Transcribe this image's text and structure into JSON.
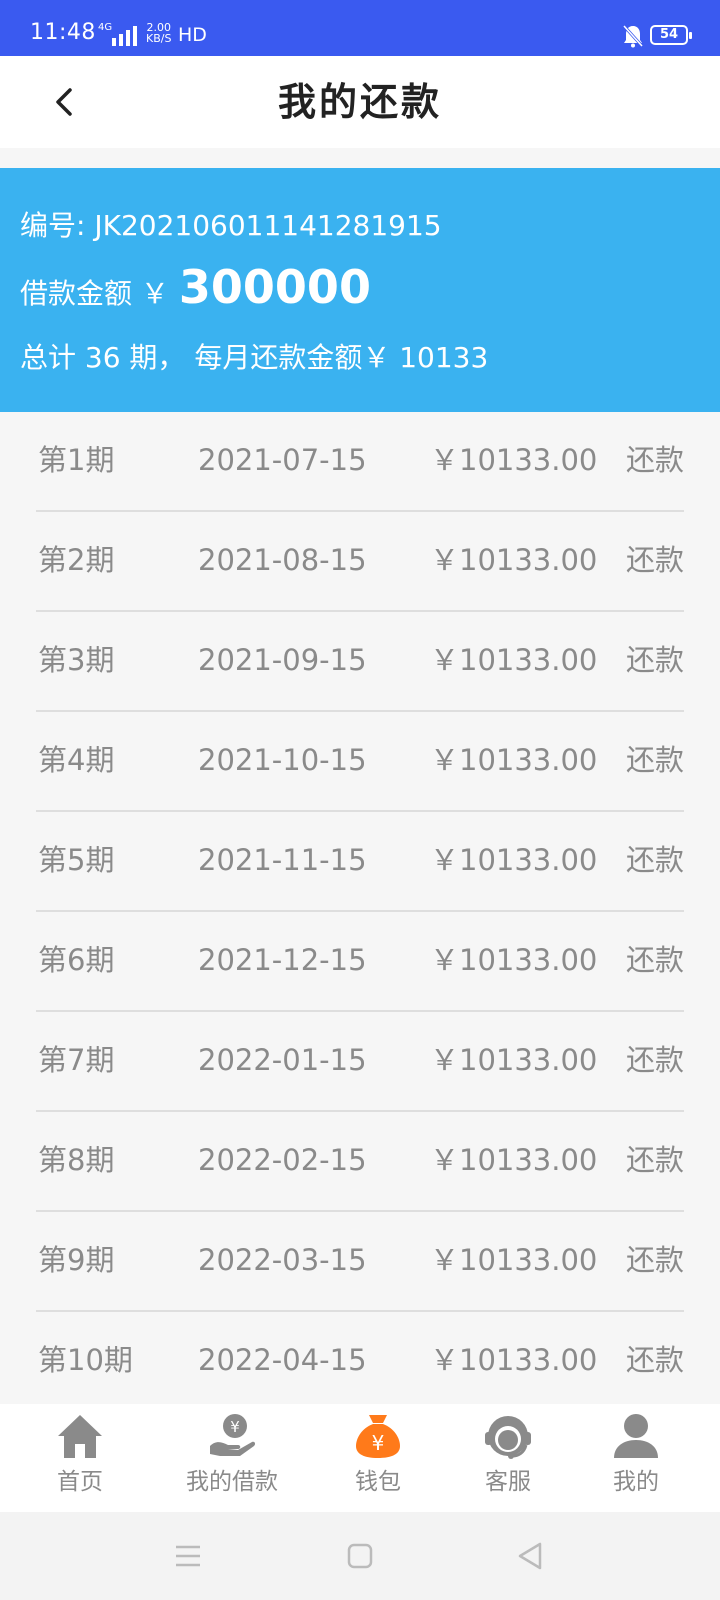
{
  "status_bar": {
    "time": "11:48",
    "network": "4G",
    "speed_value": "2.00",
    "speed_unit": "KB/S",
    "hd": "HD",
    "battery": "54"
  },
  "header": {
    "title": "我的还款"
  },
  "summary": {
    "code_label": "编号:",
    "code": "JK20210601114128191​5",
    "amount_label": "借款金额 ￥",
    "amount": "300000",
    "plan_text": "总计 36 期， 每月还款金额￥ 10133"
  },
  "installments": [
    {
      "period": "第1期",
      "date": "2021-07-15",
      "amount": "￥10133.00",
      "action": "还款"
    },
    {
      "period": "第2期",
      "date": "2021-08-15",
      "amount": "￥10133.00",
      "action": "还款"
    },
    {
      "period": "第3期",
      "date": "2021-09-15",
      "amount": "￥10133.00",
      "action": "还款"
    },
    {
      "period": "第4期",
      "date": "2021-10-15",
      "amount": "￥10133.00",
      "action": "还款"
    },
    {
      "period": "第5期",
      "date": "2021-11-15",
      "amount": "￥10133.00",
      "action": "还款"
    },
    {
      "period": "第6期",
      "date": "2021-12-15",
      "amount": "￥10133.00",
      "action": "还款"
    },
    {
      "period": "第7期",
      "date": "2022-01-15",
      "amount": "￥10133.00",
      "action": "还款"
    },
    {
      "period": "第8期",
      "date": "2022-02-15",
      "amount": "￥10133.00",
      "action": "还款"
    },
    {
      "period": "第9期",
      "date": "2022-03-15",
      "amount": "￥10133.00",
      "action": "还款"
    },
    {
      "period": "第10期",
      "date": "2022-04-15",
      "amount": "￥10133.00",
      "action": "还款"
    }
  ],
  "tabs": [
    {
      "label": "首页",
      "icon": "home-icon"
    },
    {
      "label": "我的借款",
      "icon": "loan-hand-icon"
    },
    {
      "label": "钱包",
      "icon": "money-bag-icon"
    },
    {
      "label": "客服",
      "icon": "customer-service-icon"
    },
    {
      "label": "我的",
      "icon": "user-icon"
    }
  ],
  "colors": {
    "status_bar": "#3a5af0",
    "summary_bg": "#3ab2f0",
    "active_tab": "#ff7a1a",
    "inactive_tab": "#8a8a8a"
  }
}
